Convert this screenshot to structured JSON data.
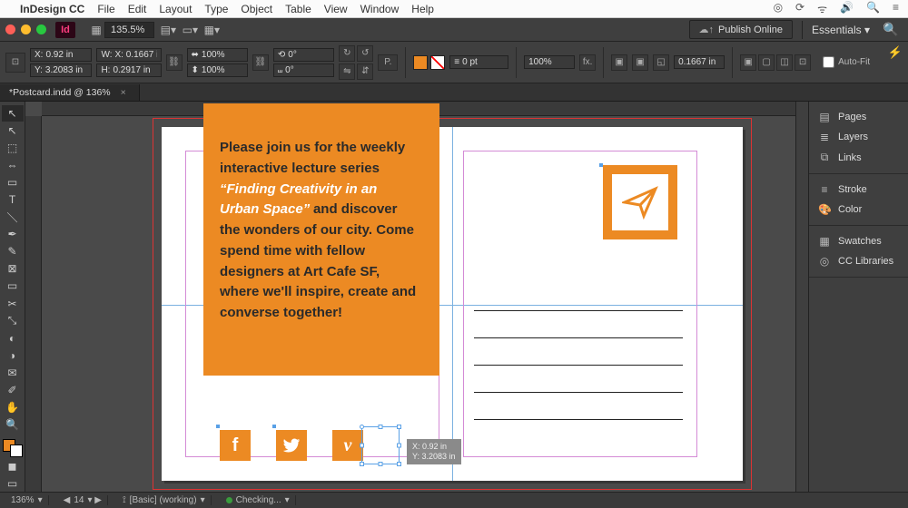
{
  "mac_menu": {
    "app": "InDesign CC",
    "items": [
      "File",
      "Edit",
      "Layout",
      "Type",
      "Object",
      "Table",
      "View",
      "Window",
      "Help"
    ],
    "right_icons": [
      "cc-icon",
      "sync-icon",
      "wifi-icon",
      "battery-icon",
      "search-icon",
      "menu-icon"
    ]
  },
  "app_bar": {
    "zoom": "135.5%",
    "publish": "Publish Online",
    "workspace": "Essentials"
  },
  "control_strip": {
    "x": "0.92 in",
    "y": "3.2083 in",
    "w": "X: 0.1667 in",
    "h": "0.2917 in",
    "scale_x": "100%",
    "scale_y": "100%",
    "rotate": "0°",
    "shear": "0°",
    "stroke_weight": "0 pt",
    "opacity": "100%",
    "frame_w": "0.1667 in",
    "autofit": "Auto-Fit"
  },
  "document": {
    "tab": "*Postcard.indd @ 136%",
    "postcard_text": {
      "lead": "Please join us for the weekly interactive lecture series ",
      "quote": "“Finding Creativity in an Urban Space”",
      "tail": " and discover the wonders of our city. Come spend time with fellow designers at Art Cafe SF, where we'll inspire, create and converse together!"
    },
    "social": [
      "f",
      "t",
      "v"
    ],
    "coord_tip": {
      "x": "X: 0.92 in",
      "y": "Y: 3.2083 in"
    }
  },
  "right_dock": {
    "grp1": [
      "Pages",
      "Layers",
      "Links"
    ],
    "grp2": [
      "Stroke",
      "Color"
    ],
    "grp3": [
      "Swatches",
      "CC Libraries"
    ]
  },
  "status": {
    "zoom": "136%",
    "pages": "14",
    "preset": "[Basic] (working)",
    "preflight": "Checking..."
  }
}
